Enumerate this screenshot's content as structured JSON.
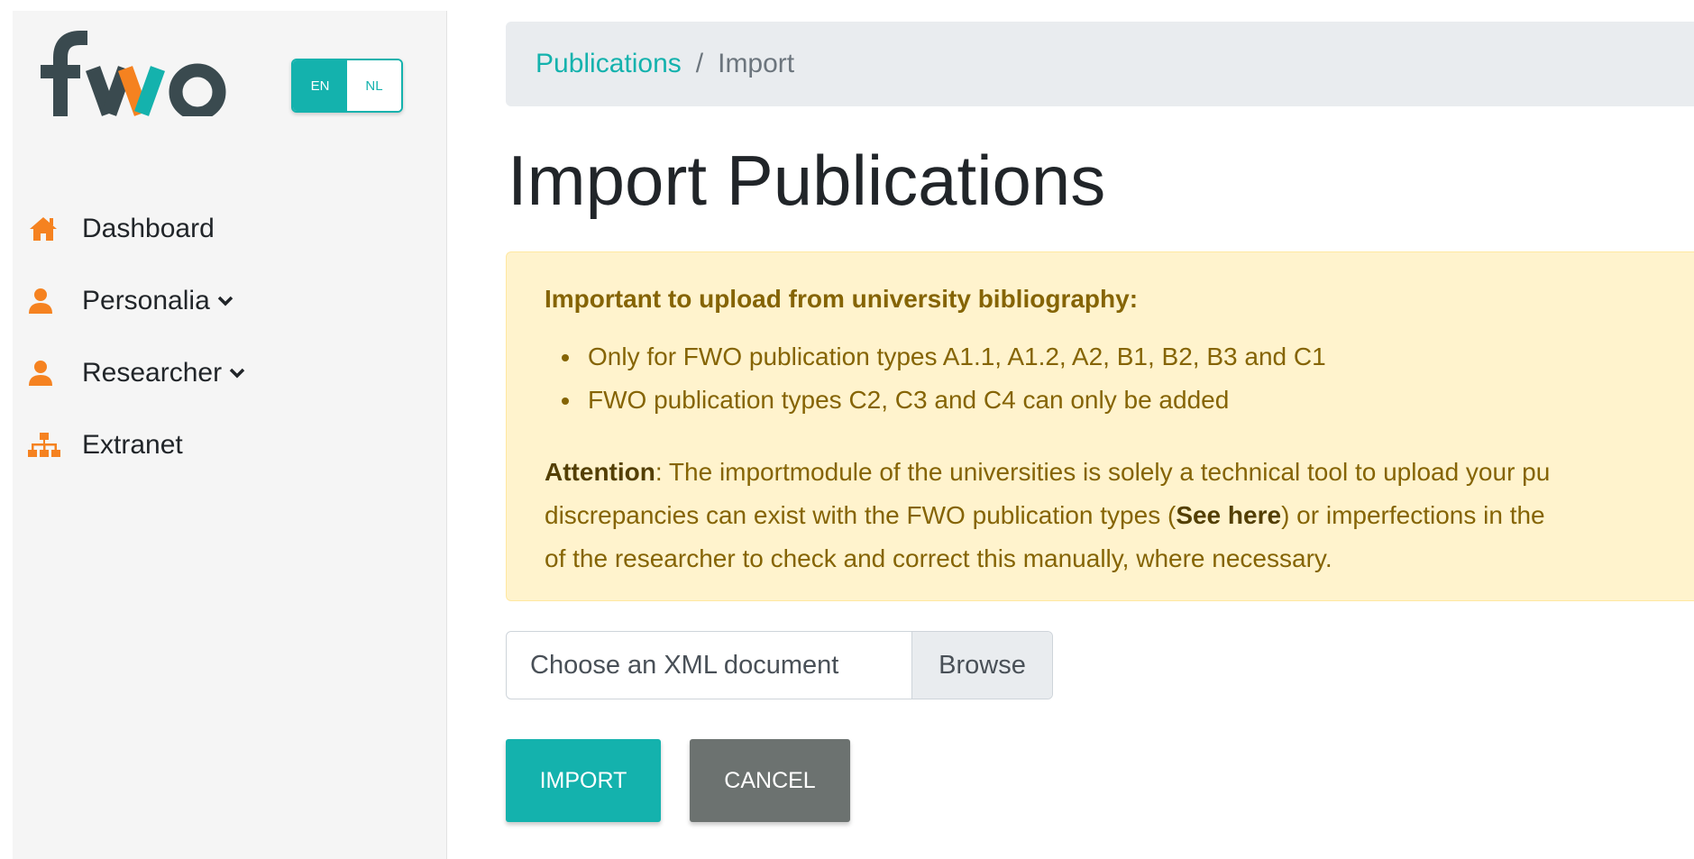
{
  "brand": {
    "logo_text": "fwo",
    "colors": {
      "teal": "#14b2ad",
      "orange": "#f58220",
      "dark": "#3a4a4f",
      "alert_bg": "#fff3cd",
      "alert_text": "#856404"
    }
  },
  "language": {
    "options": [
      {
        "code": "EN",
        "active": true
      },
      {
        "code": "NL",
        "active": false
      }
    ]
  },
  "sidebar": {
    "items": [
      {
        "label": "Dashboard",
        "icon": "home-icon",
        "has_dropdown": false
      },
      {
        "label": "Personalia",
        "icon": "user-icon",
        "has_dropdown": true
      },
      {
        "label": "Researcher",
        "icon": "user-icon",
        "has_dropdown": true
      },
      {
        "label": "Extranet",
        "icon": "sitemap-icon",
        "has_dropdown": false
      }
    ]
  },
  "breadcrumb": {
    "link": "Publications",
    "separator": "/",
    "current": "Import"
  },
  "page": {
    "title": "Import Publications"
  },
  "alert": {
    "heading": "Important to upload from university bibliography:",
    "bullets": [
      "Only for FWO publication types A1.1, A1.2, A2, B1, B2, B3 and C1",
      "FWO publication types C2, C3 and C4 can only be added"
    ],
    "attention_label": "Attention",
    "attention_line1": ": The importmodule of the universities is solely a technical tool to upload your pu",
    "attention_line2_pre": "discrepancies can exist with the FWO publication types (",
    "see_here": "See here",
    "attention_line2_post": ") or imperfections in the",
    "attention_line3": "of the researcher to check and correct this manually, where necessary."
  },
  "upload": {
    "placeholder": "Choose an XML document",
    "browse_label": "Browse"
  },
  "actions": {
    "import_label": "IMPORT",
    "cancel_label": "CANCEL"
  }
}
